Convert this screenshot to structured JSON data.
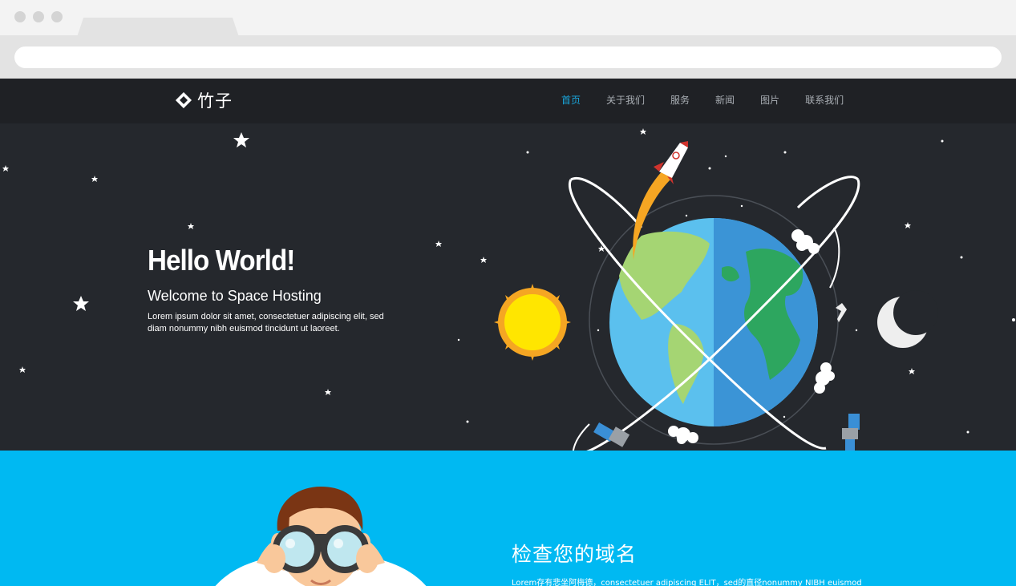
{
  "logo": {
    "text": "竹子"
  },
  "nav": {
    "items": [
      {
        "label": "首页",
        "active": true
      },
      {
        "label": "关于我们",
        "active": false
      },
      {
        "label": "服务",
        "active": false
      },
      {
        "label": "新闻",
        "active": false
      },
      {
        "label": "图片",
        "active": false
      },
      {
        "label": "联系我们",
        "active": false
      }
    ]
  },
  "hero": {
    "title": "Hello World!",
    "subtitle": "Welcome to Space Hosting",
    "description": "Lorem ipsum dolor sit amet, consectetuer adipiscing elit, sed diam nonummy nibh euismod tincidunt ut laoreet."
  },
  "domain_section": {
    "title": "检查您的域名",
    "description": "Lorem存有悲坐阿梅德，consectetuer adipiscing ELIT，sed的直径nonummy NIBH euismod"
  },
  "colors": {
    "nav_bg": "#1f2125",
    "hero_bg": "#25282d",
    "accent": "#1aa6dc",
    "section_blue": "#00b9f2"
  },
  "icons": [
    "logo-diamond-icon",
    "rocket-icon",
    "earth-icon",
    "sun-icon",
    "moon-icon",
    "satellite-icon",
    "plane-icon",
    "cloud-icon",
    "star-icon",
    "binoculars-man-illustration"
  ]
}
